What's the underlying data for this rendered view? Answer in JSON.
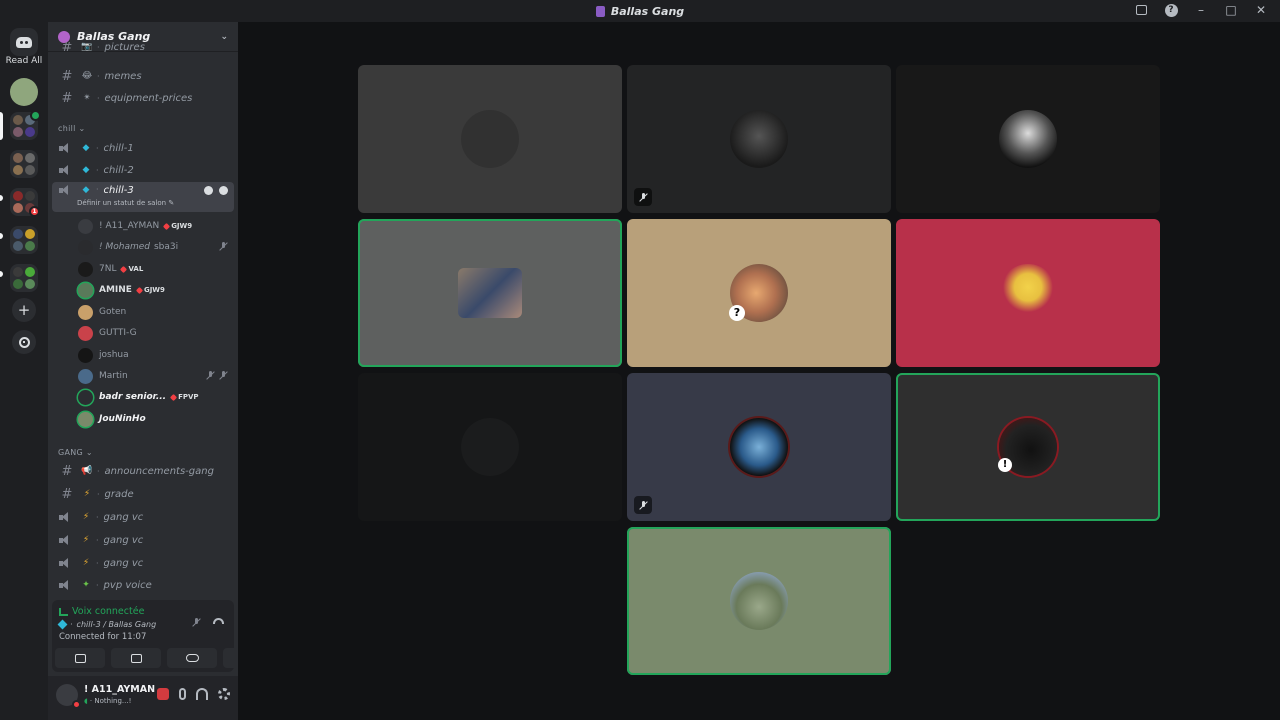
{
  "window": {
    "title": "Ballas Gang"
  },
  "guilds": {
    "read_all": "Read All",
    "badge_1": "1"
  },
  "server": {
    "name": "Ballas Gang"
  },
  "channels": {
    "pictures": "pictures",
    "memes": "memes",
    "equipment_prices": "equipment-prices",
    "cat_chill": "chill ⌄",
    "chill_1": "chill-1",
    "chill_2": "chill-2",
    "chill_3": "chill-3",
    "chill_3_sub": "Définir un statut de salon ✎",
    "cat_gang": "GANG ⌄",
    "announcements_gang": "announcements-gang",
    "grade": "grade",
    "gang_vc_1": "gang vc",
    "gang_vc_2": "gang vc",
    "gang_vc_3": "gang vc",
    "pvp_voice": "pvp voice"
  },
  "voice_users": [
    {
      "name": "! A11_AYMAN",
      "tag": "GJW9"
    },
    {
      "name": "! Mohamed",
      "extra": "sba3i"
    },
    {
      "name": "7NL",
      "tag": "VAL"
    },
    {
      "name": "AMINE",
      "tag": "GJW9"
    },
    {
      "name": "Goten"
    },
    {
      "name": "GUTTI-G"
    },
    {
      "name": "joshua"
    },
    {
      "name": "Martin"
    },
    {
      "name": "badr senior...",
      "tag": "FPVP"
    },
    {
      "name": "JouNinHo"
    }
  ],
  "voice_panel": {
    "status": "Voix connectée",
    "channel": "chill-3 / Ballas Gang",
    "connected_for": "Connected for 11:07"
  },
  "user": {
    "name": "! A11_AYMAN",
    "status": "Nothing...!"
  },
  "colors": {
    "accent_green": "#23a55a",
    "dnd_red": "#f23f43",
    "bg": "#111214",
    "sidebar": "#2b2d31"
  }
}
